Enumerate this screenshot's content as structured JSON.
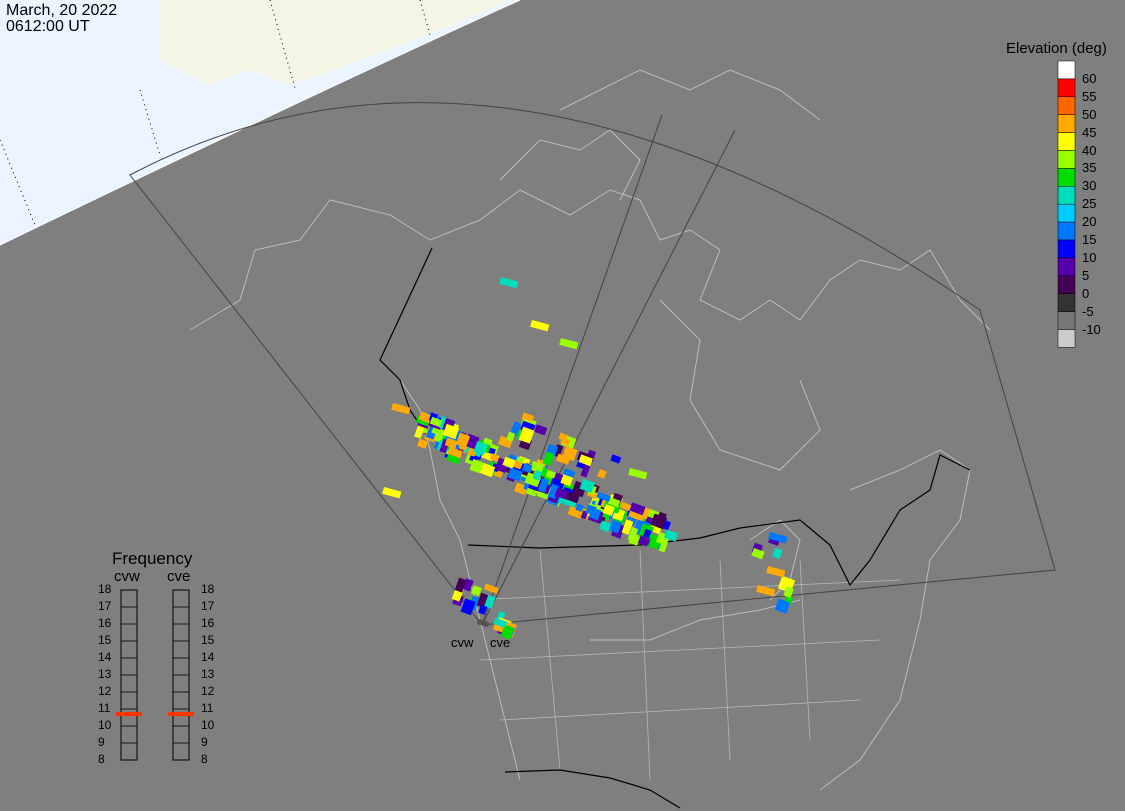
{
  "header": {
    "date": "March, 20 2022",
    "time": "0612:00 UT"
  },
  "colorbar": {
    "title": "Elevation (deg)",
    "labels": [
      "60",
      "55",
      "50",
      "45",
      "40",
      "35",
      "30",
      "25",
      "20",
      "15",
      "10",
      "5",
      "0",
      "-5",
      "-10"
    ],
    "colors": [
      "#ffffff",
      "#ff0000",
      "#ff6600",
      "#ffaa00",
      "#ffff00",
      "#99ff00",
      "#00dd00",
      "#00ddbb",
      "#00ccff",
      "#0077ff",
      "#0000ff",
      "#5500aa",
      "#440055",
      "#333333",
      "#777777",
      "#cccccc"
    ]
  },
  "frequency": {
    "title": "Frequency",
    "radars": [
      {
        "name": "cvw",
        "freq_mhz": 10.7
      },
      {
        "name": "cve",
        "freq_mhz": 10.7
      }
    ],
    "scale": [
      "18",
      "17",
      "16",
      "15",
      "14",
      "13",
      "12",
      "11",
      "10",
      "9",
      "8"
    ],
    "marker_color": "#ff3300"
  },
  "sites": [
    "cvw",
    "cve"
  ]
}
